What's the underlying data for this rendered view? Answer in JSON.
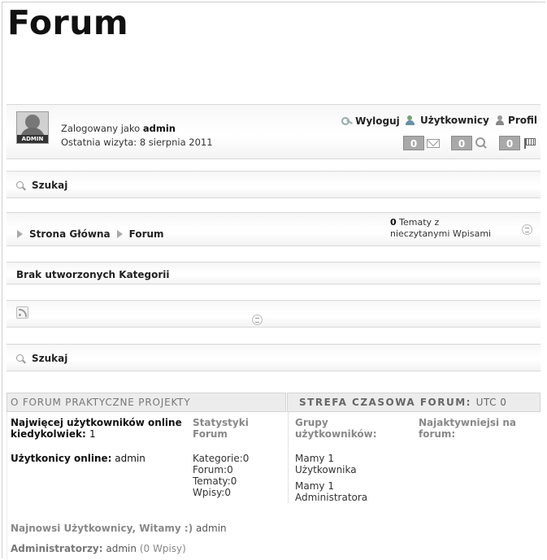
{
  "page_title": "Forum",
  "user_bar": {
    "avatar_tag": "ADMIN",
    "logged_prefix": "Zalogowany jako",
    "username": "admin",
    "last_visit": "Ostatnia wizyta: 8 sierpnia 2011",
    "logout": "Wyloguj",
    "users": "Użytkownicy",
    "profile": "Profil",
    "messages_count": "0",
    "search_count": "0",
    "reports_count": "0"
  },
  "search_label": "Szukaj",
  "breadcrumb": {
    "home": "Strona Główna",
    "forum": "Forum"
  },
  "unread": {
    "count": "0",
    "line1": "Tematy z",
    "line2": "nieczytanymi Wpisami"
  },
  "no_categories": "Brak utworzonych Kategorii",
  "info": {
    "about_header": "O FORUM PRAKTYCZNE PROJEKTY",
    "timezone_header": "STREFA CZASOWA FORUM:",
    "timezone_value": "UTC 0",
    "most_online_label": "Najwięcej użytkowników online kiedykolwiek:",
    "most_online_value": "1",
    "stats_title": "Statystyki Forum",
    "groups_title": "Grupy użytkowników:",
    "active_title": "Najaktywniejsi na forum:",
    "online_label": "Użytkonicy online:",
    "online_value": "admin",
    "stats": [
      "Kategorie:0",
      "Forum:0",
      "Tematy:0",
      "Wpisy:0"
    ],
    "groups": [
      "Mamy 1 Użytkownika",
      "Mamy 1 Administratora"
    ],
    "newest_label": "Najnowsi Użytkownicy, Witamy :)",
    "newest_value": "admin",
    "admins_label": "Administratorzy:",
    "admins_name": "admin",
    "admins_posts": "(0 Wpisy)"
  }
}
